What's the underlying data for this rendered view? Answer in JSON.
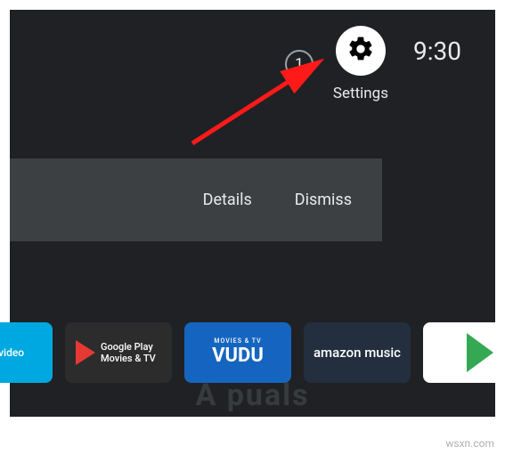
{
  "status": {
    "notification_count": "1",
    "settings_label": "Settings",
    "clock": "9:30"
  },
  "notification_card": {
    "action_details": "Details",
    "action_dismiss": "Dismiss"
  },
  "app_tiles": {
    "prime_video": "rime video",
    "google_play_movies": "Google Play\nMovies & TV",
    "vudu_top": "MOVIES & TV",
    "vudu_main": "VUDU",
    "amazon_music": "amazon music",
    "google_play": ""
  },
  "watermark": {
    "main": "A  puals",
    "corner": "wsxn.com"
  }
}
